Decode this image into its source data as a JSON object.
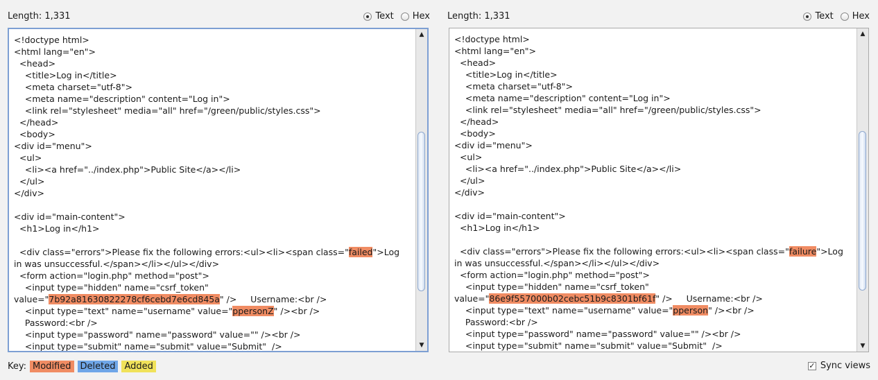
{
  "left": {
    "length_text": "Length: 1,331",
    "modes": {
      "text_label": "Text",
      "hex_label": "Hex",
      "selected": "Text"
    },
    "lines": [
      [
        {
          "t": "<!doctype html>"
        }
      ],
      [
        {
          "t": "<html lang=\"en\">"
        }
      ],
      [
        {
          "t": "  <head>"
        }
      ],
      [
        {
          "t": "    <title>Log in</title>"
        }
      ],
      [
        {
          "t": "    <meta charset=\"utf-8\">"
        }
      ],
      [
        {
          "t": "    <meta name=\"description\" content=\"Log in\">"
        }
      ],
      [
        {
          "t": "    <link rel=\"stylesheet\" media=\"all\" href=\"/green/public/styles.css\">"
        }
      ],
      [
        {
          "t": "  </head>"
        }
      ],
      [
        {
          "t": "  <body>"
        }
      ],
      [
        {
          "t": "<div id=\"menu\">"
        }
      ],
      [
        {
          "t": "  <ul>"
        }
      ],
      [
        {
          "t": "    <li><a href=\"../index.php\">Public Site</a></li>"
        }
      ],
      [
        {
          "t": "  </ul>"
        }
      ],
      [
        {
          "t": "</div>"
        }
      ],
      [
        {
          "t": ""
        }
      ],
      [
        {
          "t": "<div id=\"main-content\">"
        }
      ],
      [
        {
          "t": "  <h1>Log in</h1>"
        }
      ],
      [
        {
          "t": ""
        }
      ],
      [
        {
          "t": "  <div class=\"errors\">Please fix the following errors:<ul><li><span class=\""
        },
        {
          "t": "failed",
          "hl": true
        },
        {
          "t": "\">Log"
        }
      ],
      [
        {
          "t": "in was unsuccessful.</span></li></ul></div>"
        }
      ],
      [
        {
          "t": "  <form action=\"login.php\" method=\"post\">"
        }
      ],
      [
        {
          "t": "    <input type=\"hidden\" name=\"csrf_token\""
        }
      ],
      [
        {
          "t": "value=\""
        },
        {
          "t": "7b92a81630822278cf6cebd7e6cd845a",
          "hl": true
        },
        {
          "t": "\" />     Username:<br />"
        }
      ],
      [
        {
          "t": "    <input type=\"text\" name=\"username\" value=\""
        },
        {
          "t": "ppersonZ",
          "hl": true
        },
        {
          "t": "\" /><br />"
        }
      ],
      [
        {
          "t": "    Password:<br />"
        }
      ],
      [
        {
          "t": "    <input type=\"password\" name=\"password\" value=\"\" /><br />"
        }
      ],
      [
        {
          "t": "    <input type=\"submit\" name=\"submit\" value=\"Submit\"  />"
        }
      ]
    ]
  },
  "right": {
    "length_text": "Length: 1,331",
    "modes": {
      "text_label": "Text",
      "hex_label": "Hex",
      "selected": "Text"
    },
    "lines": [
      [
        {
          "t": "<!doctype html>"
        }
      ],
      [
        {
          "t": "<html lang=\"en\">"
        }
      ],
      [
        {
          "t": "  <head>"
        }
      ],
      [
        {
          "t": "    <title>Log in</title>"
        }
      ],
      [
        {
          "t": "    <meta charset=\"utf-8\">"
        }
      ],
      [
        {
          "t": "    <meta name=\"description\" content=\"Log in\">"
        }
      ],
      [
        {
          "t": "    <link rel=\"stylesheet\" media=\"all\" href=\"/green/public/styles.css\">"
        }
      ],
      [
        {
          "t": "  </head>"
        }
      ],
      [
        {
          "t": "  <body>"
        }
      ],
      [
        {
          "t": "<div id=\"menu\">"
        }
      ],
      [
        {
          "t": "  <ul>"
        }
      ],
      [
        {
          "t": "    <li><a href=\"../index.php\">Public Site</a></li>"
        }
      ],
      [
        {
          "t": "  </ul>"
        }
      ],
      [
        {
          "t": "</div>"
        }
      ],
      [
        {
          "t": ""
        }
      ],
      [
        {
          "t": "<div id=\"main-content\">"
        }
      ],
      [
        {
          "t": "  <h1>Log in</h1>"
        }
      ],
      [
        {
          "t": ""
        }
      ],
      [
        {
          "t": "  <div class=\"errors\">Please fix the following errors:<ul><li><span class=\""
        },
        {
          "t": "failure",
          "hl": true
        },
        {
          "t": "\">Log"
        }
      ],
      [
        {
          "t": "in was unsuccessful.</span></li></ul></div>"
        }
      ],
      [
        {
          "t": "  <form action=\"login.php\" method=\"post\">"
        }
      ],
      [
        {
          "t": "    <input type=\"hidden\" name=\"csrf_token\""
        }
      ],
      [
        {
          "t": "value=\""
        },
        {
          "t": "86e9f557000b02cebc51b9c8301bf61f",
          "hl": true
        },
        {
          "t": "\" />     Username:<br />"
        }
      ],
      [
        {
          "t": "    <input type=\"text\" name=\"username\" value=\""
        },
        {
          "t": "pperson",
          "hl": true
        },
        {
          "t": "\" /><br />"
        }
      ],
      [
        {
          "t": "    Password:<br />"
        }
      ],
      [
        {
          "t": "    <input type=\"password\" name=\"password\" value=\"\" /><br />"
        }
      ],
      [
        {
          "t": "    <input type=\"submit\" name=\"submit\" value=\"Submit\"  />"
        }
      ]
    ]
  },
  "footer": {
    "key_label": "Key:",
    "modified_label": "Modified",
    "deleted_label": "Deleted",
    "added_label": "Added",
    "sync_label": "Sync views",
    "sync_checked": true
  },
  "colors": {
    "modified": "#f08c63",
    "deleted": "#6fa6e8",
    "added": "#f0e25a",
    "focus_border": "#7d9fd3"
  }
}
